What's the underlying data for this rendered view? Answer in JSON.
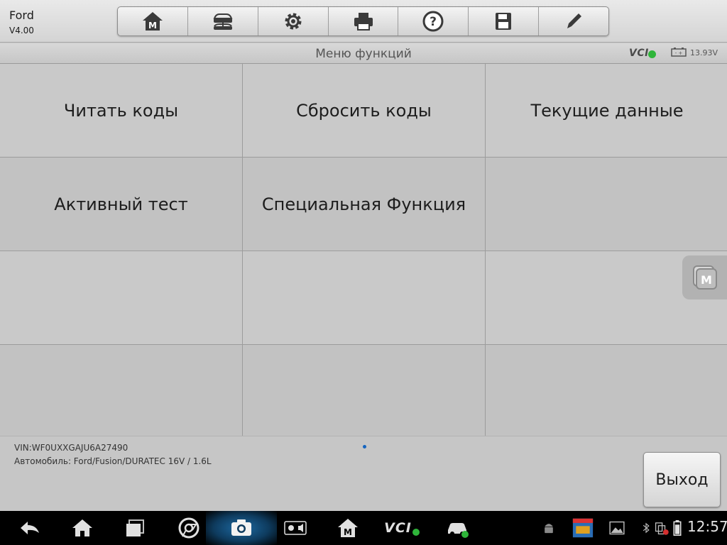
{
  "app": {
    "name": "Ford",
    "version": "V4.00"
  },
  "toolbar": {
    "buttons": [
      {
        "name": "home-button",
        "icon": "home-m-icon"
      },
      {
        "name": "vehicle-swap-button",
        "icon": "car-swap-icon"
      },
      {
        "name": "settings-button",
        "icon": "gear-icon"
      },
      {
        "name": "print-button",
        "icon": "printer-icon"
      },
      {
        "name": "help-button",
        "icon": "help-icon"
      },
      {
        "name": "save-button",
        "icon": "floppy-icon"
      },
      {
        "name": "edit-button",
        "icon": "pencil-icon"
      }
    ]
  },
  "header": {
    "title": "Меню функций",
    "vci_label": "VCI",
    "voltage": "13.93V"
  },
  "menu": {
    "items": [
      "Читать коды",
      "Сбросить коды",
      "Текущие данные",
      "Активный тест",
      "Специальная Функция",
      "",
      "",
      "",
      "",
      "",
      "",
      ""
    ]
  },
  "footer": {
    "vin": "VIN:WF0UXXGAJU6A27490",
    "vehicle": "Автомобиль: Ford/Fusion/DURATEC 16V / 1.6L",
    "exit_label": "Выход"
  },
  "navbar": {
    "vci_label": "VCI",
    "time": "12:57"
  },
  "colors": {
    "accent": "#1565c0",
    "ok": "#2fb53a",
    "background": "#c9c9c9"
  }
}
